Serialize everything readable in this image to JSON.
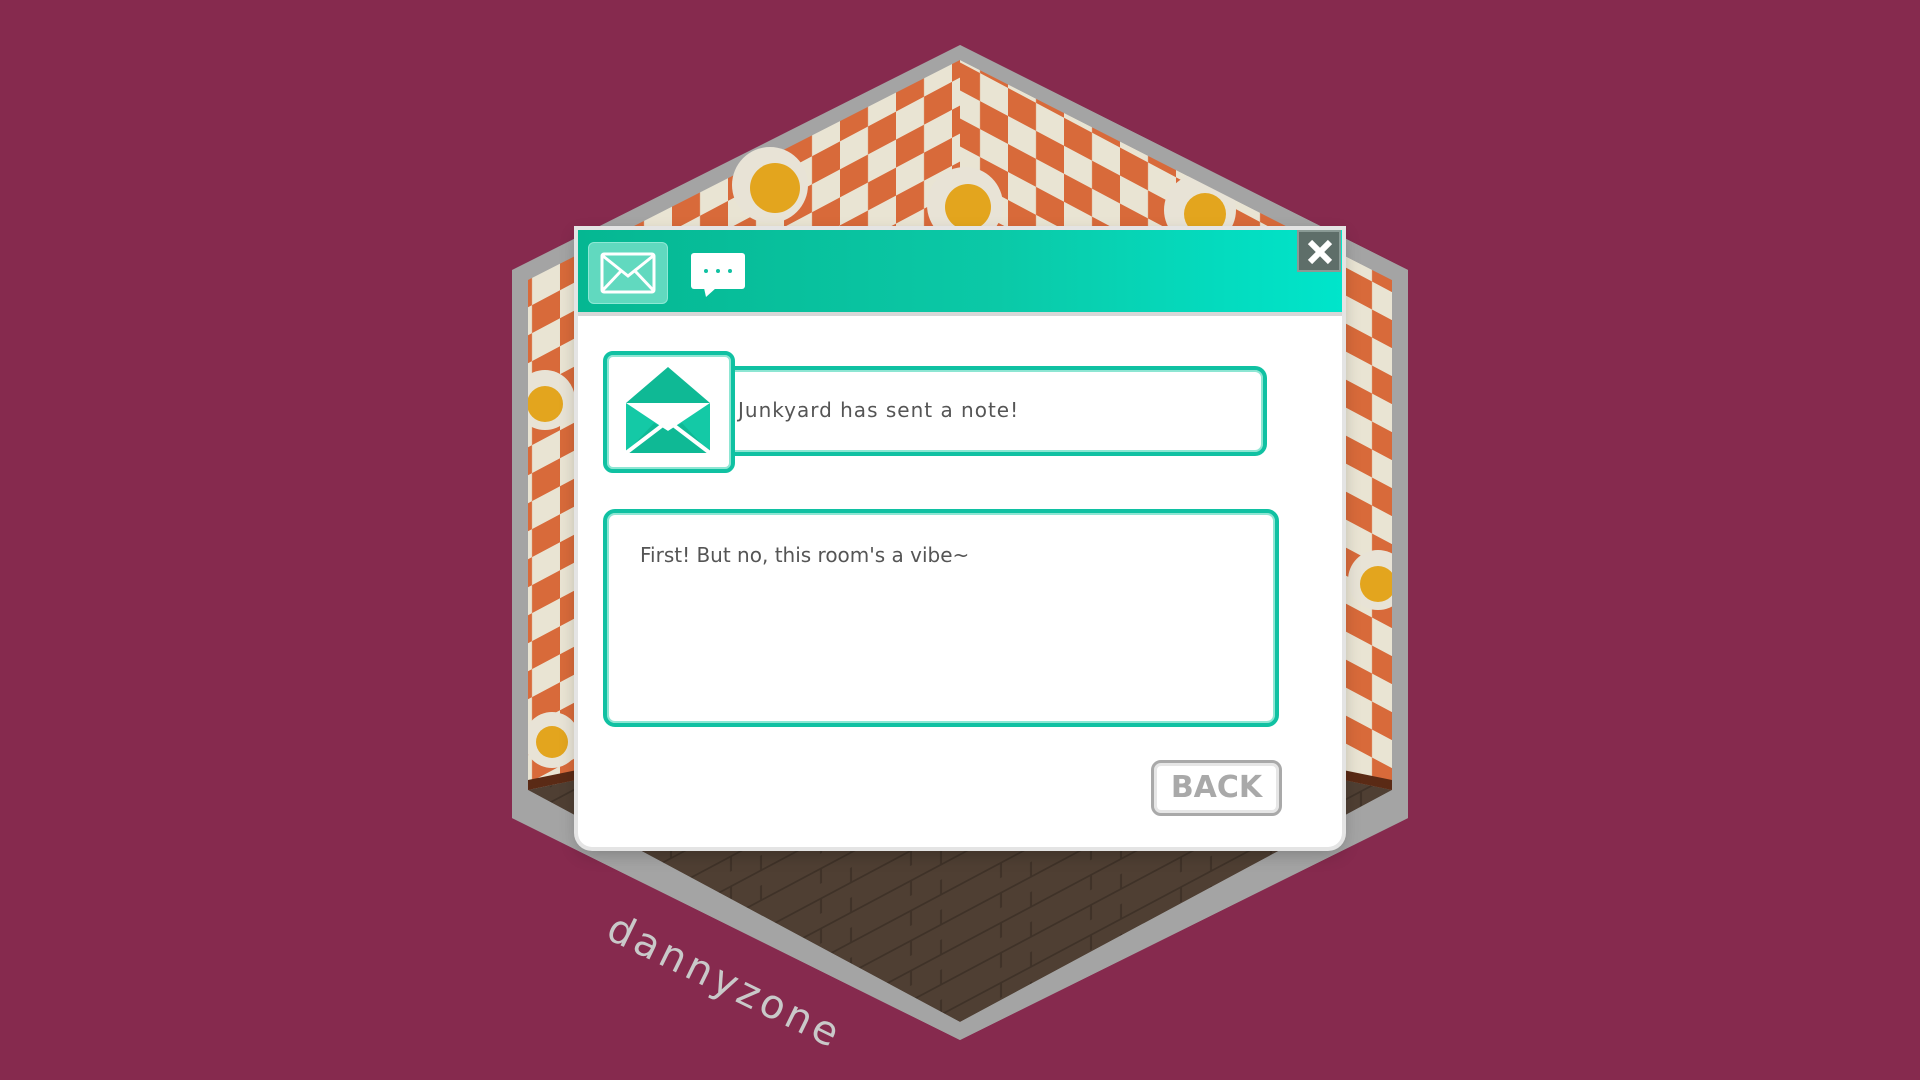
{
  "room": {
    "owner": "dannyzone",
    "background_color": "#862a4e",
    "wallpaper": "orange and cream checkerboard with smiley daisies",
    "floor": "dark wood planks"
  },
  "mail_window": {
    "tabs": [
      {
        "id": "mail",
        "icon": "envelope-icon",
        "selected": true
      },
      {
        "id": "chat",
        "icon": "speech-bubble-icon",
        "selected": false
      }
    ],
    "close_icon": "close-icon",
    "sender_icon": "open-envelope-icon",
    "sender_line": "Junkyard has sent a note!",
    "message": "First! But no, this room's a vibe~",
    "back_label": "BACK",
    "accent_color": "#10c1a2"
  }
}
